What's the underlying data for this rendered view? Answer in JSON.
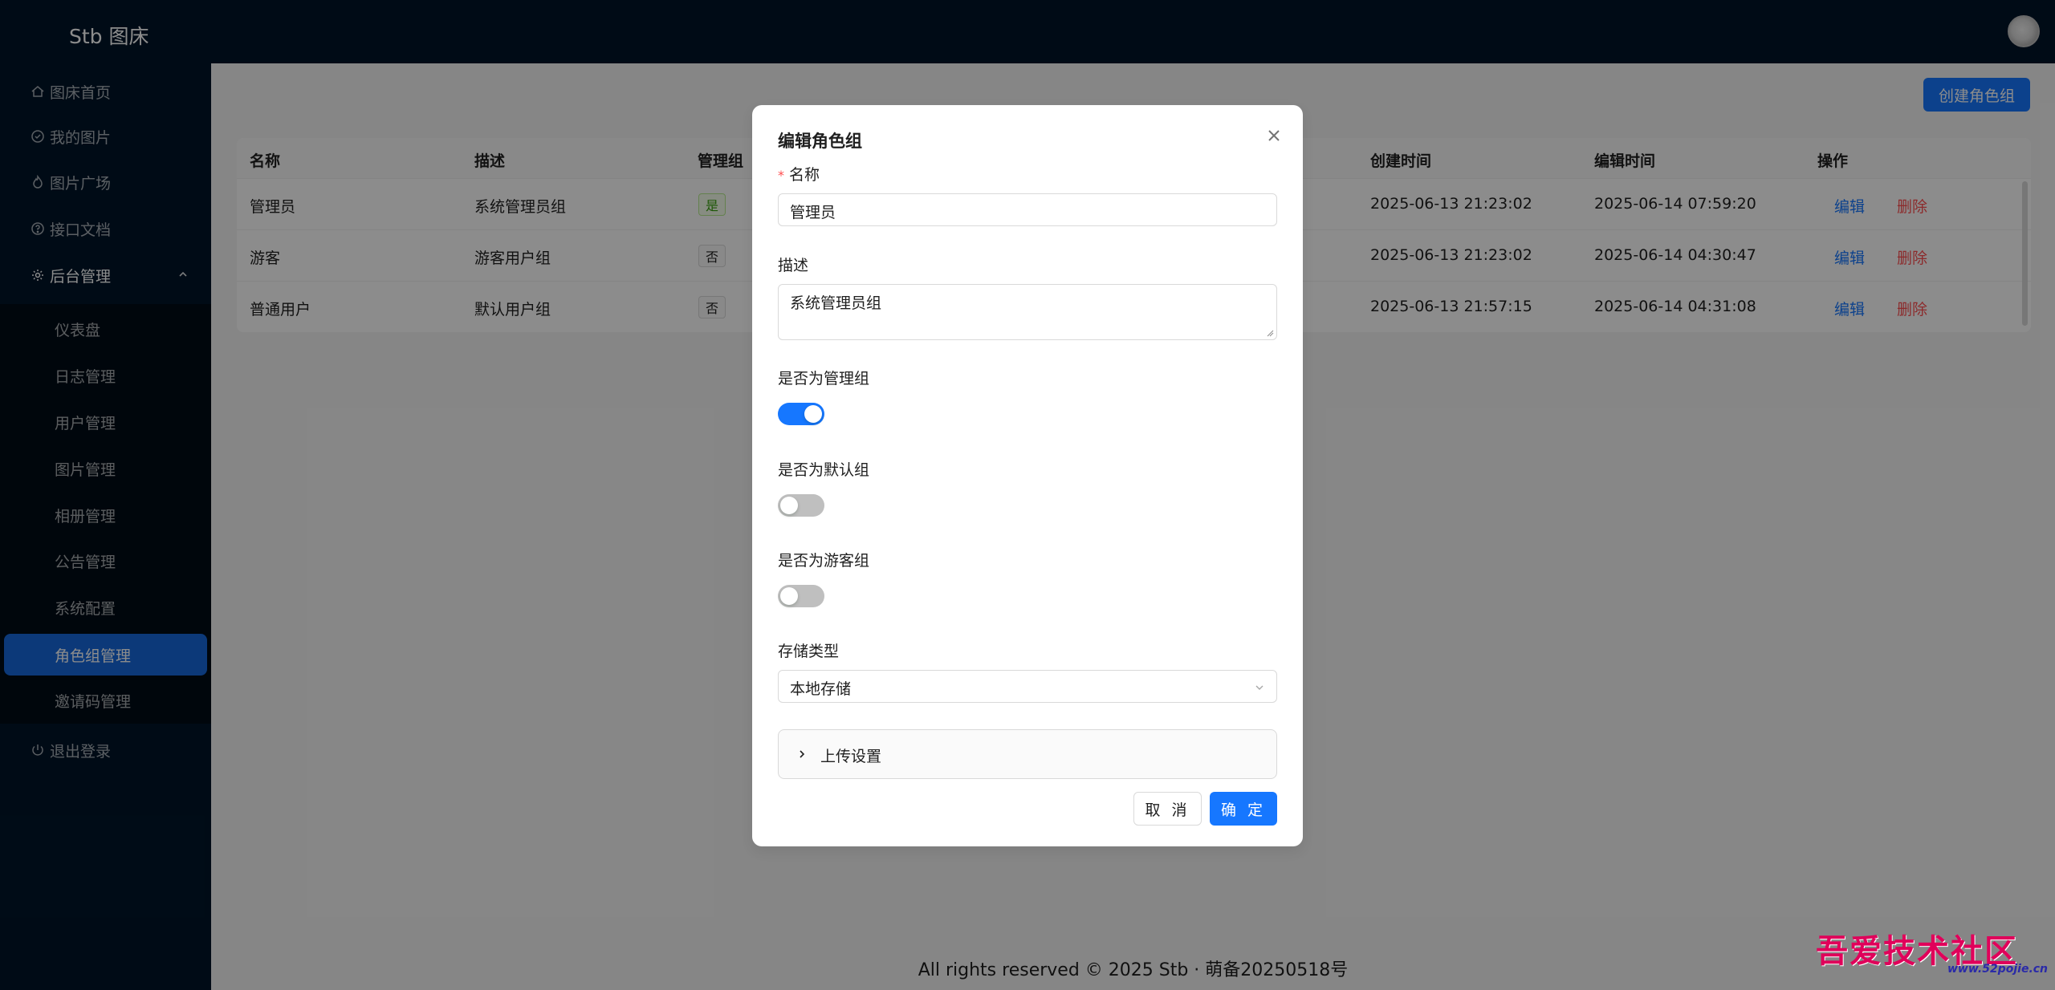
{
  "header": {
    "brand": "Stb 图床"
  },
  "sidebar": {
    "items": [
      {
        "label": "图床首页",
        "icon": "home-icon"
      },
      {
        "label": "我的图片",
        "icon": "picture-icon"
      },
      {
        "label": "图片广场",
        "icon": "fire-icon"
      },
      {
        "label": "接口文档",
        "icon": "question-icon"
      },
      {
        "label": "后台管理",
        "icon": "setting-icon"
      }
    ],
    "submenu": [
      {
        "label": "仪表盘"
      },
      {
        "label": "日志管理"
      },
      {
        "label": "用户管理"
      },
      {
        "label": "图片管理"
      },
      {
        "label": "相册管理"
      },
      {
        "label": "公告管理"
      },
      {
        "label": "系统配置"
      },
      {
        "label": "角色组管理"
      },
      {
        "label": "邀请码管理"
      }
    ],
    "logout": "退出登录"
  },
  "toolbar": {
    "create_label": "创建角色组"
  },
  "table": {
    "headers": [
      "名称",
      "描述",
      "管理组",
      "创建时间",
      "编辑时间",
      "操作"
    ],
    "rows": [
      {
        "name": "管理员",
        "desc": "系统管理员组",
        "admin": "是",
        "created": "2025-06-13 21:23:02",
        "edited": "2025-06-14 07:59:20"
      },
      {
        "name": "游客",
        "desc": "游客用户组",
        "admin": "否",
        "created": "2025-06-13 21:23:02",
        "edited": "2025-06-14 04:30:47"
      },
      {
        "name": "普通用户",
        "desc": "默认用户组",
        "admin": "否",
        "created": "2025-06-13 21:57:15",
        "edited": "2025-06-14 04:31:08"
      }
    ],
    "edit_label": "编辑",
    "delete_label": "删除"
  },
  "modal": {
    "title": "编辑角色组",
    "name_label": "名称",
    "name_value": "管理员",
    "desc_label": "描述",
    "desc_value": "系统管理员组",
    "is_admin_label": "是否为管理组",
    "is_admin": true,
    "is_default_label": "是否为默认组",
    "is_default": false,
    "is_guest_label": "是否为游客组",
    "is_guest": false,
    "storage_label": "存储类型",
    "storage_value": "本地存储",
    "upload_settings_label": "上传设置",
    "cancel_label": "取 消",
    "ok_label": "确 定"
  },
  "footer": {
    "text": "All rights reserved © 2025 Stb · 萌备20250518号"
  },
  "watermark": {
    "text": "吾爱技术社区",
    "url": "www.52pojie.cn"
  },
  "colors": {
    "primary": "#1677ff",
    "sidebar_bg": "#001529",
    "danger": "#ff4d4f"
  }
}
